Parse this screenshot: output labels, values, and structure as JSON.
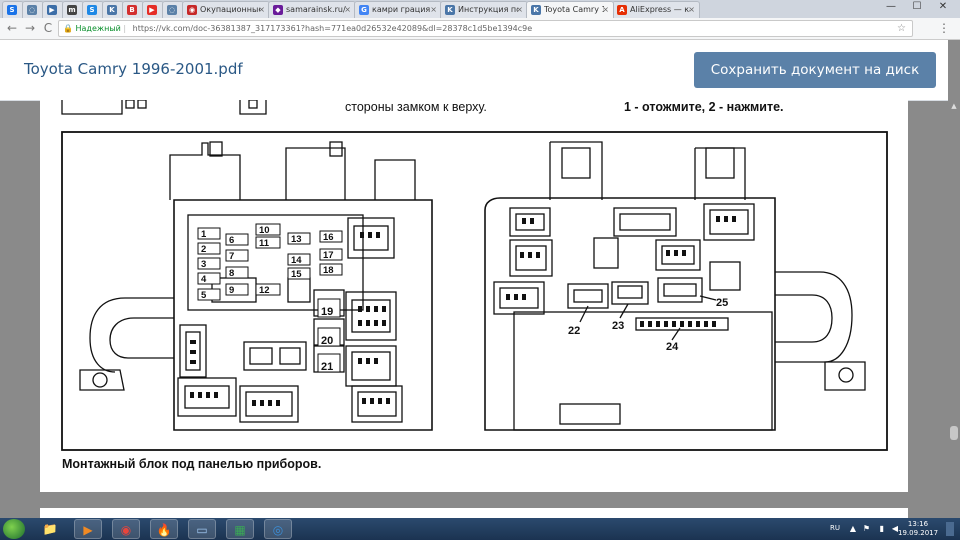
{
  "browser": {
    "tabs": [
      {
        "label": "",
        "favicon": "S",
        "color": "#1a73e8"
      },
      {
        "label": "",
        "favicon": "◌",
        "color": "#5b81a8"
      },
      {
        "label": "",
        "favicon": "▶",
        "color": "#3c6ea8"
      },
      {
        "label": "",
        "favicon": "m",
        "color": "#444"
      },
      {
        "label": "",
        "favicon": "S",
        "color": "#1e88e5"
      },
      {
        "label": "",
        "favicon": "K",
        "color": "#4a76a8"
      },
      {
        "label": "",
        "favicon": "B",
        "color": "#d32f2f"
      },
      {
        "label": "",
        "favicon": "▶",
        "color": "#e52d27"
      },
      {
        "label": "",
        "favicon": "◌",
        "color": "#5b81a8"
      },
      {
        "label": "Окупационные си",
        "favicon": "◉",
        "color": "#c62828"
      },
      {
        "label": "samarainsk.ru/index",
        "favicon": "◆",
        "color": "#6a1b9a"
      },
      {
        "label": "камри грация инстр",
        "favicon": "G",
        "color": "#4285f4"
      },
      {
        "label": "Инструкция по эксп",
        "favicon": "K",
        "color": "#4a76a8"
      },
      {
        "label": "Toyota Camry 1996-",
        "favicon": "K",
        "color": "#4a76a8"
      },
      {
        "label": "AliExpress — качеств",
        "favicon": "A",
        "color": "#e62e04"
      }
    ],
    "active_tab_index": 13,
    "window_controls": {
      "minimize": "—",
      "maximize": "☐",
      "close": "✕"
    },
    "nav": {
      "back": "←",
      "forward": "→",
      "reload": "C"
    },
    "security_label": "Надежный",
    "url": "https://vk.com/doc-36381387_317173361?hash=771ea0d26532e42089&dl=28378c1d5be1394c9e",
    "menu_icon": "⋮"
  },
  "doc": {
    "title": "Toyota Camry 1996-2001.pdf",
    "save_button": "Сохранить документ на диск"
  },
  "page": {
    "top_text_left": "стороны замком к верху.",
    "top_text_right": "1 - отожмите, 2 - нажмите.",
    "caption": "Монтажный блок под панелью приборов.",
    "fuse_labels": [
      "1",
      "2",
      "3",
      "4",
      "5",
      "6",
      "7",
      "8",
      "9",
      "10",
      "11",
      "12",
      "13",
      "14",
      "15",
      "16",
      "17",
      "18",
      "19",
      "20",
      "21"
    ],
    "connector_labels": [
      "22",
      "23",
      "24",
      "25"
    ]
  },
  "taskbar": {
    "apps": [
      "explorer-icon",
      "media-player-icon",
      "chrome-icon",
      "firefox-icon",
      "window-icon",
      "excel-icon",
      "app-icon"
    ],
    "language": "RU",
    "time": "13:16",
    "date": "19.09.2017"
  },
  "colors": {
    "vk_link": "#2a5885",
    "vk_button": "#5b81a8",
    "secure_green": "#0a8f2c"
  }
}
